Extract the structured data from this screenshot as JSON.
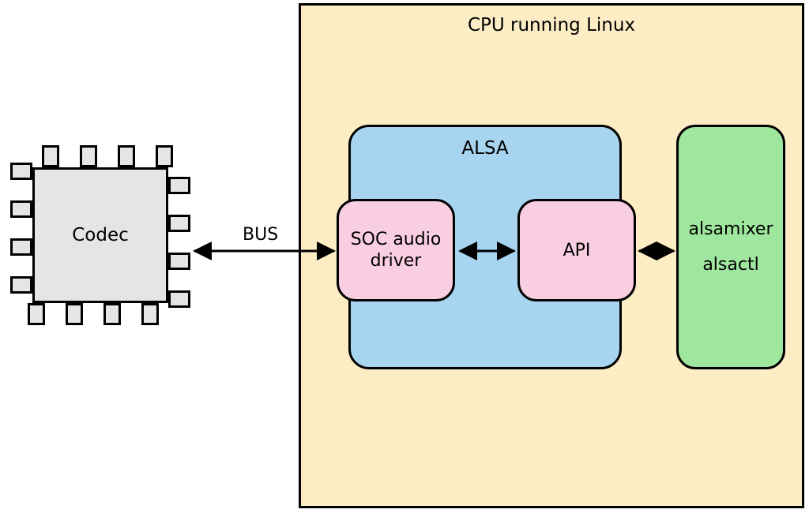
{
  "diagram": {
    "cpu_title": "CPU running Linux",
    "alsa_title": "ALSA",
    "soc_label": "SOC audio\ndriver",
    "api_label": "API",
    "tools": {
      "alsamixer": "alsamixer",
      "alsactl": "alsactl"
    },
    "codec_label": "Codec",
    "bus_label": "BUS",
    "colors": {
      "cpu_bg": "#fdedc5",
      "alsa_bg": "#a7d5ef",
      "pink_bg": "#f9cee0",
      "tools_bg": "#9fe69e",
      "chip_bg": "#e5e5e5"
    },
    "connections": [
      {
        "from": "codec",
        "to": "soc_audio_driver",
        "label": "BUS",
        "bidirectional": true
      },
      {
        "from": "soc_audio_driver",
        "to": "api",
        "bidirectional": true
      },
      {
        "from": "api",
        "to": "tools",
        "bidirectional": true
      }
    ]
  }
}
